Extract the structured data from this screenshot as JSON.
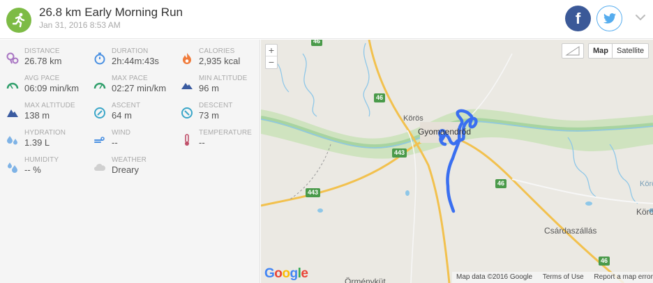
{
  "header": {
    "title": "26.8 km Early Morning Run",
    "subtitle": "Jan 31, 2016 8:53 AM",
    "activity_icon": "runner-icon",
    "facebook_label": "f",
    "colors": {
      "activity": "#7dbb45",
      "facebook": "#3b5998",
      "twitter": "#55acee"
    }
  },
  "stats": [
    {
      "label": "DISTANCE",
      "value": "26.78 km",
      "icon": "distance-pin-icon",
      "color": "#a874c2"
    },
    {
      "label": "DURATION",
      "value": "2h:44m:43s",
      "icon": "stopwatch-icon",
      "color": "#4a90e2"
    },
    {
      "label": "CALORIES",
      "value": "2,935 kcal",
      "icon": "flame-icon",
      "color": "#f07c3c"
    },
    {
      "label": "AVG PACE",
      "value": "06:09 min/km",
      "icon": "gauge-icon",
      "color": "#2e9e6a"
    },
    {
      "label": "MAX PACE",
      "value": "02:27 min/km",
      "icon": "gauge-icon",
      "color": "#2e9e6a"
    },
    {
      "label": "MIN ALTITUDE",
      "value": "96 m",
      "icon": "mountain-icon",
      "color": "#3a5ba0"
    },
    {
      "label": "MAX ALTITUDE",
      "value": "138 m",
      "icon": "mountain-icon",
      "color": "#3a5ba0"
    },
    {
      "label": "ASCENT",
      "value": "64 m",
      "icon": "ascent-compass-icon",
      "color": "#3aa6c8"
    },
    {
      "label": "DESCENT",
      "value": "73 m",
      "icon": "descent-compass-icon",
      "color": "#3aa6c8"
    },
    {
      "label": "HYDRATION",
      "value": "1.39 L",
      "icon": "droplets-icon",
      "color": "#7fb3e6"
    },
    {
      "label": "WIND",
      "value": "--",
      "icon": "wind-icon",
      "color": "#4a90e2"
    },
    {
      "label": "TEMPERATURE",
      "value": "--",
      "icon": "thermometer-icon",
      "color": "#c0506a"
    },
    {
      "label": "HUMIDITY",
      "value": "-- %",
      "icon": "humidity-drops-icon",
      "color": "#7fb3e6"
    },
    {
      "label": "WEATHER",
      "value": "Dreary",
      "icon": "cloud-icon",
      "color": "#d0d0d0"
    }
  ],
  "map": {
    "zoom_in": "+",
    "zoom_out": "−",
    "type_map": "Map",
    "type_satellite": "Satellite",
    "google_logo": "Google",
    "attribution": [
      "Map data ©2016 Google",
      "Terms of Use",
      "Report a map error"
    ],
    "places": [
      "Körös",
      "Gyomaendrőd",
      "Csárdaszállás",
      "Örményküt",
      "Körö",
      "Körö"
    ],
    "road_shields": [
      "46",
      "46",
      "443",
      "443",
      "46",
      "46"
    ],
    "route_color": "#3a6ff0",
    "river_color": "#a8d4a0"
  }
}
